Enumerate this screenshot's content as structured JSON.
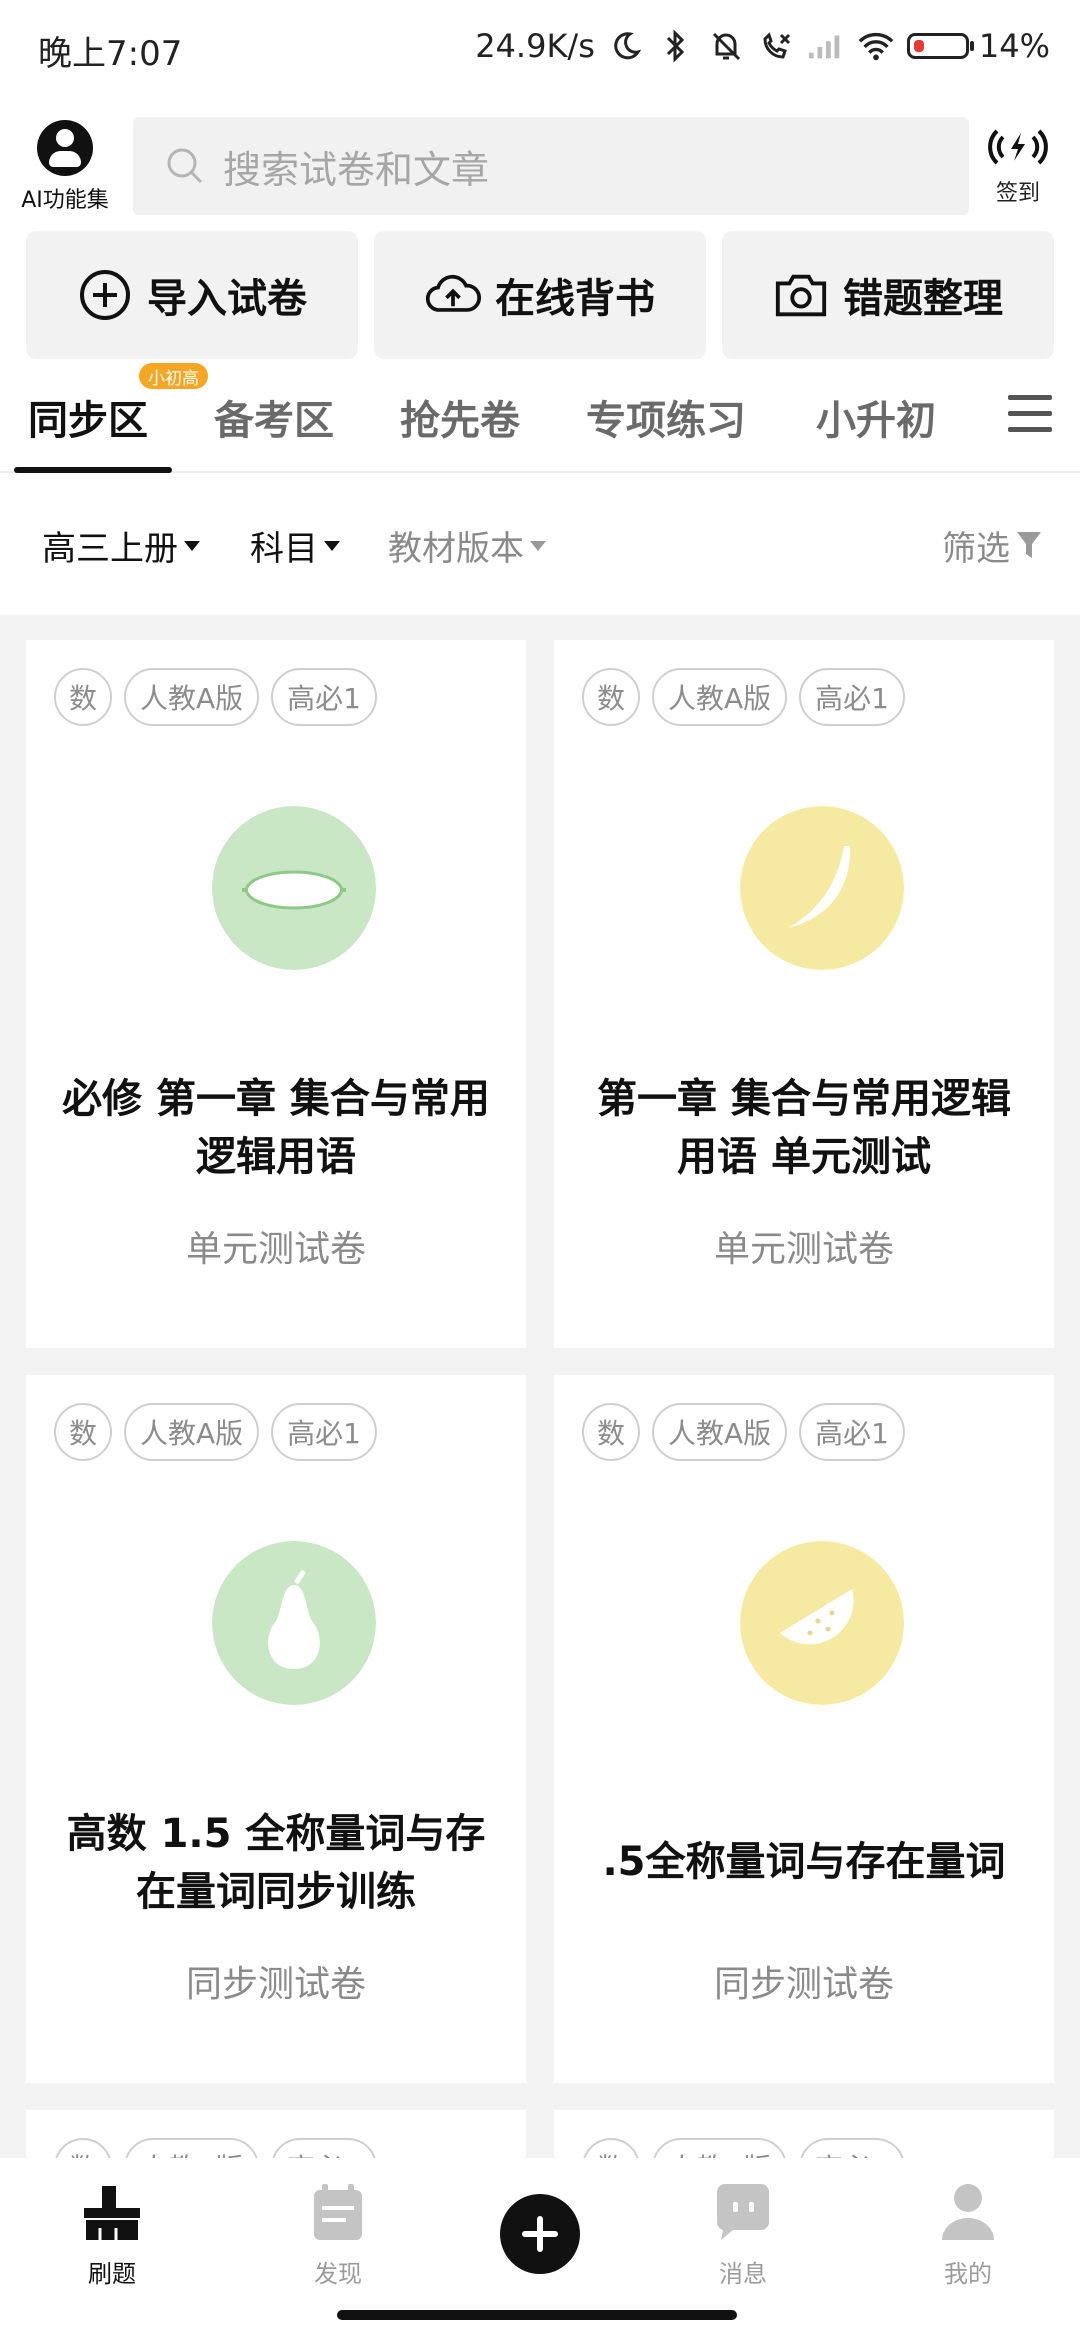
{
  "status_bar": {
    "time": "晚上7:07",
    "network_speed": "24.9K/s",
    "battery_percent": "14%",
    "battery_level": 0.14,
    "battery_color": "#e53935"
  },
  "header": {
    "ai_label": "AI功能集",
    "search_placeholder": "搜索试卷和文章",
    "signin_label": "签到"
  },
  "quick_actions": [
    {
      "label": "导入试卷",
      "icon": "plus-circle-icon"
    },
    {
      "label": "在线背书",
      "icon": "cloud-upload-icon"
    },
    {
      "label": "错题整理",
      "icon": "camera-icon"
    }
  ],
  "tabs": [
    {
      "label": "同步区",
      "active": true,
      "badge": "小初高"
    },
    {
      "label": "备考区"
    },
    {
      "label": "抢先卷"
    },
    {
      "label": "专项练习"
    },
    {
      "label": "小升初"
    }
  ],
  "filters": {
    "grade": "高三上册",
    "subject": "科目",
    "edition": "教材版本",
    "filter": "筛选"
  },
  "cards": [
    {
      "tags": [
        "数",
        "人教A版",
        "高必1"
      ],
      "illustration": "lemon-icon",
      "circle_color": "#c9e6c5",
      "title": "必修 第一章 集合与常用逻辑用语",
      "subtitle": "单元测试卷"
    },
    {
      "tags": [
        "数",
        "人教A版",
        "高必1"
      ],
      "illustration": "banana-icon",
      "circle_color": "#f6eaa3",
      "title": "第一章 集合与常用逻辑用语  单元测试",
      "subtitle": "单元测试卷"
    },
    {
      "tags": [
        "数",
        "人教A版",
        "高必1"
      ],
      "illustration": "pear-icon",
      "circle_color": "#c9e6c5",
      "title": "高数 1.5 全称量词与存在量词同步训练",
      "subtitle": "同步测试卷"
    },
    {
      "tags": [
        "数",
        "人教A版",
        "高必1"
      ],
      "illustration": "melon-slice-icon",
      "circle_color": "#f6eaa3",
      "title": ".5全称量词与存在量词",
      "subtitle": "同步测试卷"
    }
  ],
  "bottom_nav": [
    {
      "label": "刷题",
      "icon": "brush-icon",
      "active": true
    },
    {
      "label": "发现",
      "icon": "calendar-icon"
    },
    {
      "label": "消息",
      "icon": "chat-icon"
    },
    {
      "label": "我的",
      "icon": "person-icon"
    }
  ]
}
